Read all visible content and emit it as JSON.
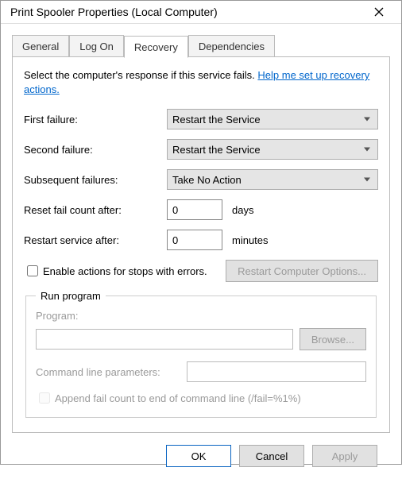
{
  "window": {
    "title": "Print Spooler Properties (Local Computer)"
  },
  "tabs": {
    "general": "General",
    "logon": "Log On",
    "recovery": "Recovery",
    "dependencies": "Dependencies"
  },
  "recovery": {
    "intro_text": "Select the computer's response if this service fails. ",
    "help_link": "Help me set up recovery actions.",
    "first_failure_label": "First failure:",
    "first_failure_value": "Restart the Service",
    "second_failure_label": "Second failure:",
    "second_failure_value": "Restart the Service",
    "subsequent_failures_label": "Subsequent failures:",
    "subsequent_failures_value": "Take No Action",
    "reset_fail_label": "Reset fail count after:",
    "reset_fail_value": "0",
    "reset_fail_unit": "days",
    "restart_after_label": "Restart service after:",
    "restart_after_value": "0",
    "restart_after_unit": "minutes",
    "enable_actions_label": "Enable actions for stops with errors.",
    "restart_options_btn": "Restart Computer Options...",
    "run_program": {
      "legend": "Run program",
      "program_label": "Program:",
      "program_value": "",
      "browse_label": "Browse...",
      "cmd_params_label": "Command line parameters:",
      "cmd_params_value": "",
      "append_label": "Append fail count to end of command line (/fail=%1%)"
    }
  },
  "buttons": {
    "ok": "OK",
    "cancel": "Cancel",
    "apply": "Apply"
  }
}
